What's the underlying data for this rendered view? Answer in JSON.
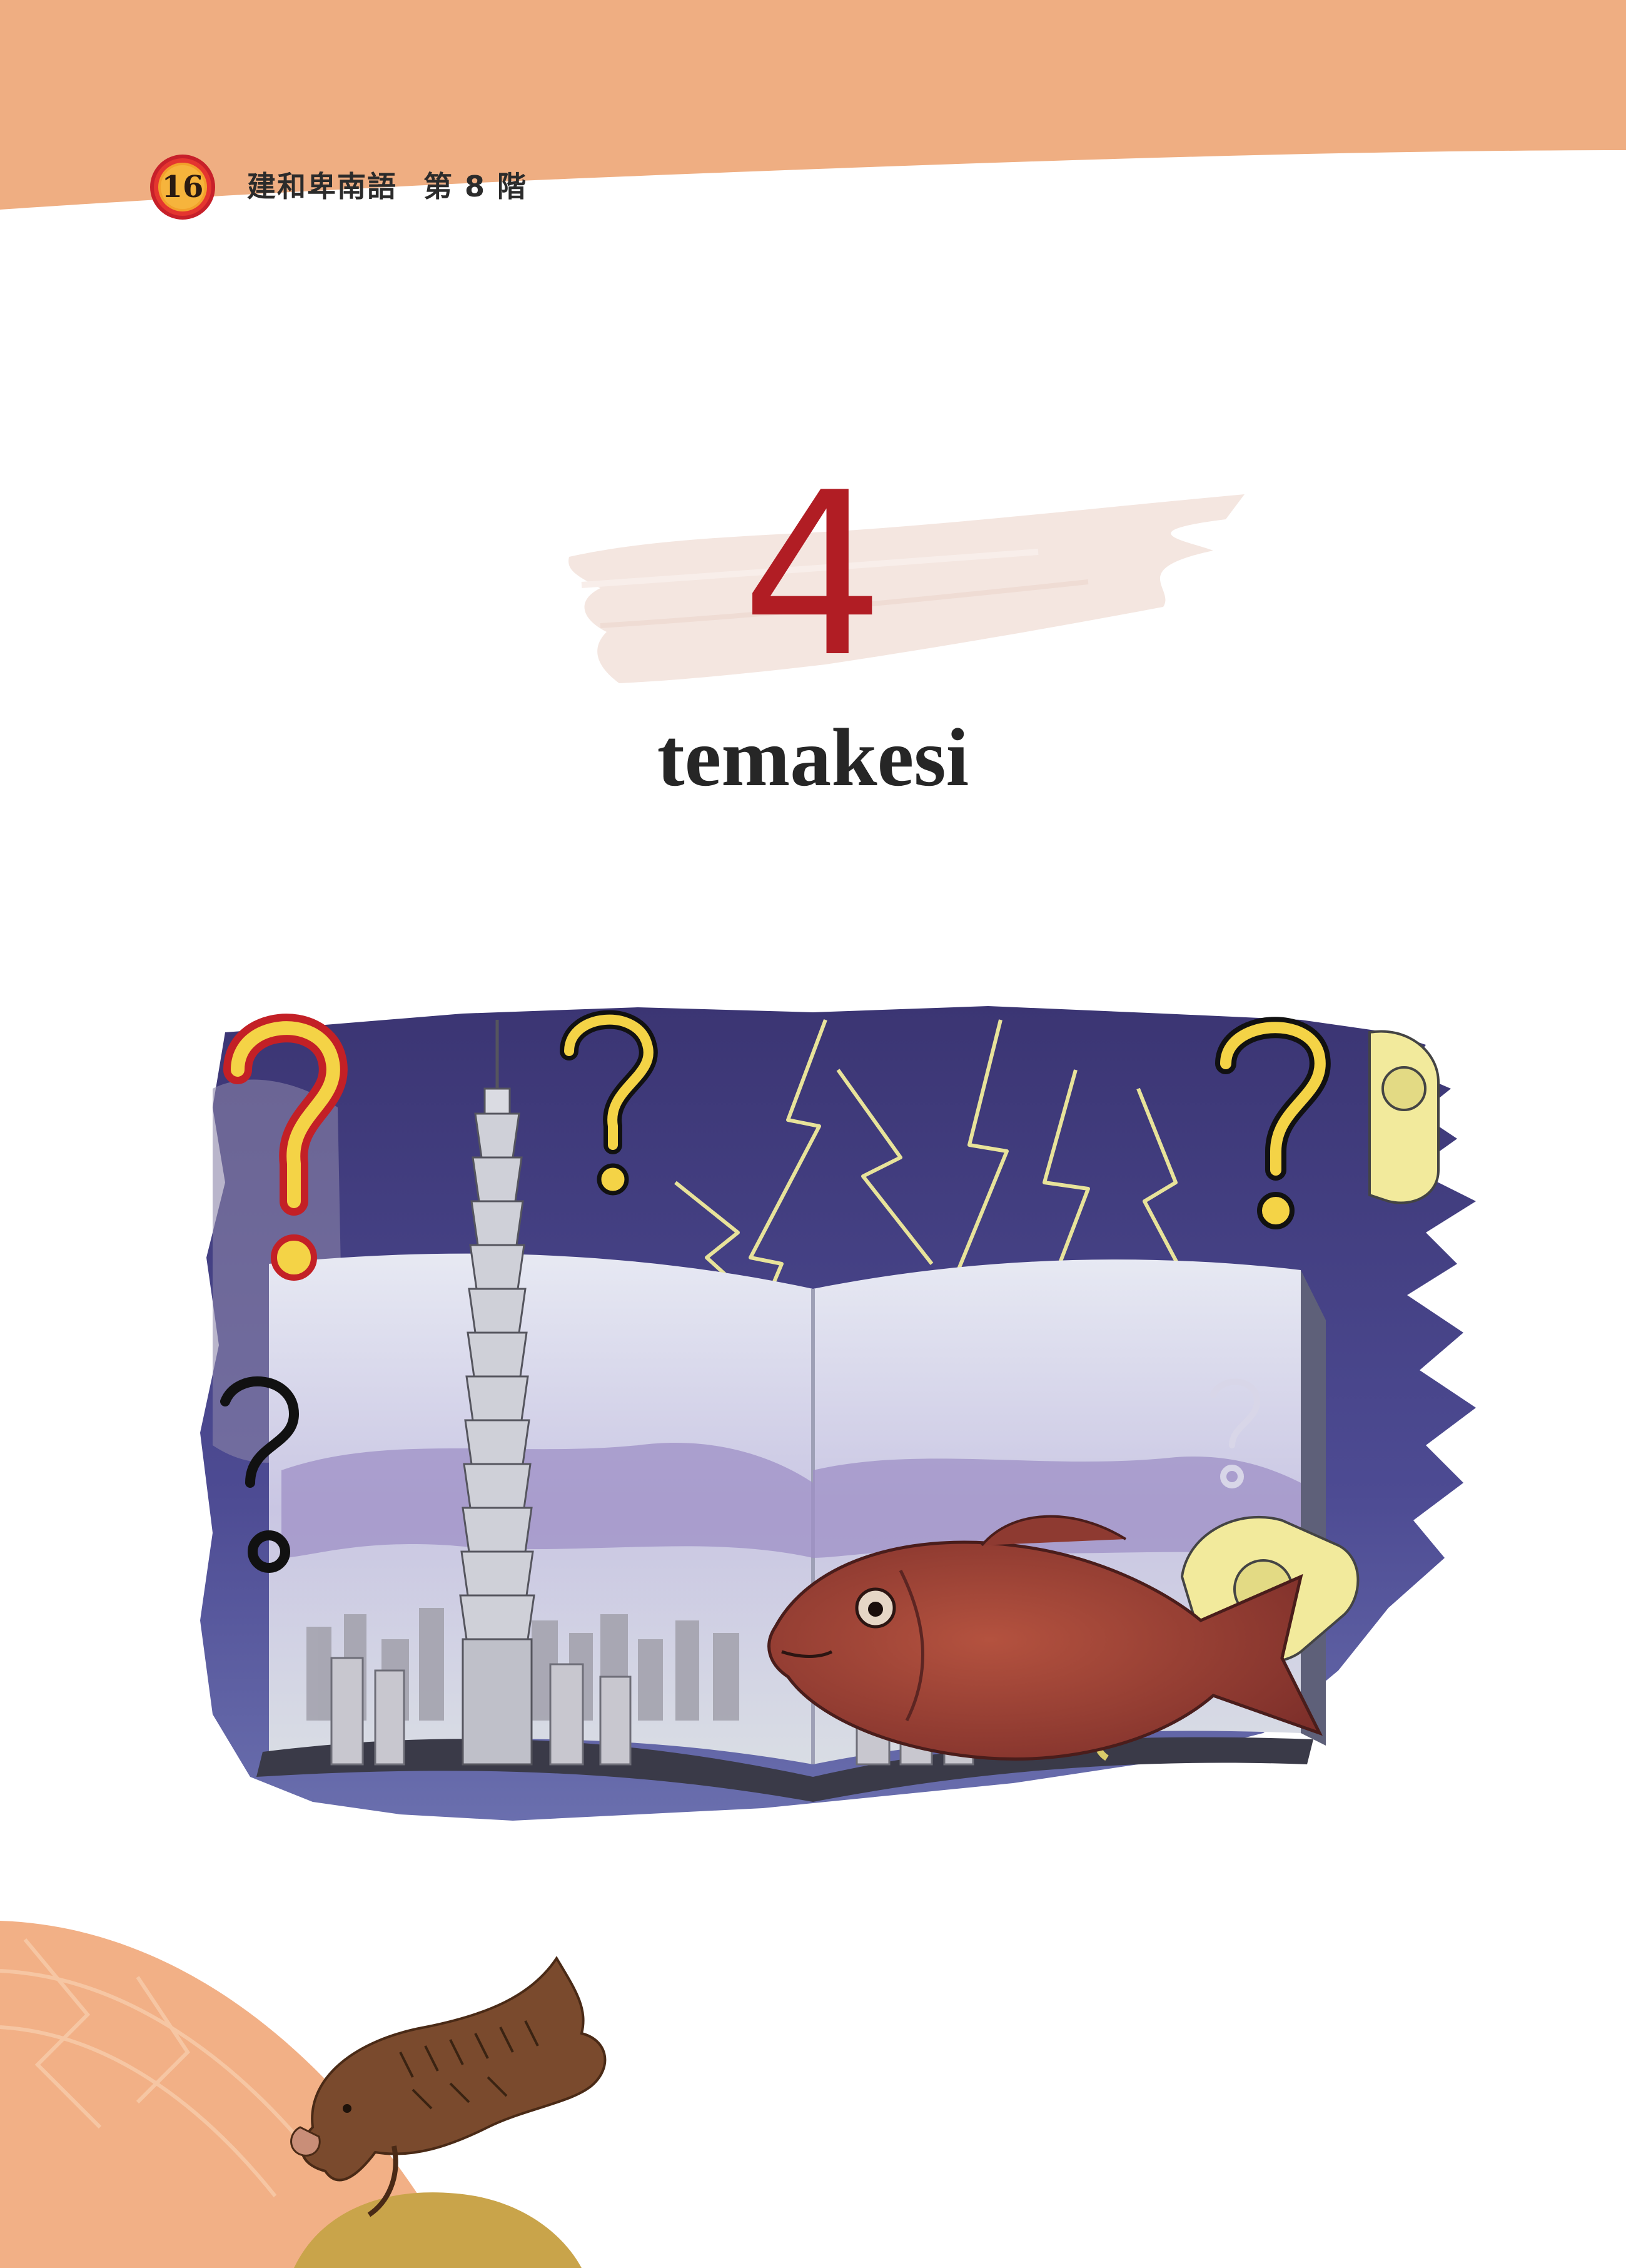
{
  "header": {
    "page_number": "16",
    "book_title": "建和卑南語",
    "level": "第 8 階"
  },
  "lesson": {
    "number": "4",
    "title": "temakesi"
  },
  "colors": {
    "header_band": "#EFAE82",
    "badge_fill": "#F2A12B",
    "badge_ring": "#C7202A",
    "lesson_number": "#B11D24",
    "brush": "#F4E6E0",
    "bottom_arc": "#F2B086",
    "bottom_gold": "#C9A44A"
  }
}
